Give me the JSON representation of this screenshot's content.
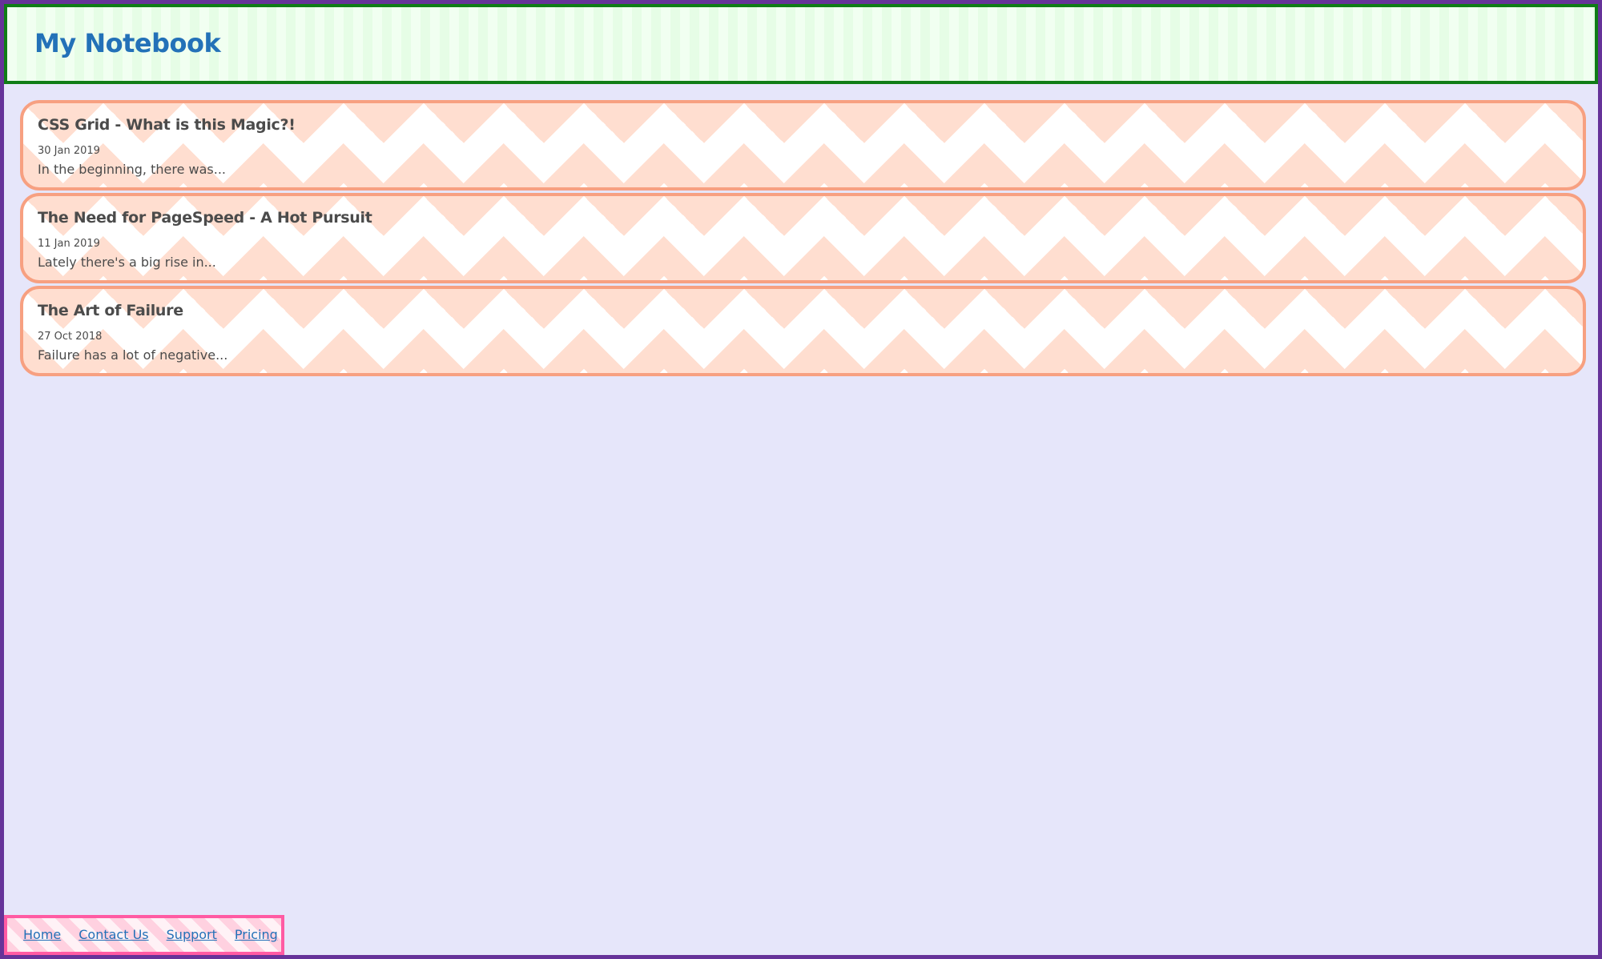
{
  "header": {
    "title": "My Notebook"
  },
  "posts": [
    {
      "title": "CSS Grid - What is this Magic?!",
      "date": "30 Jan 2019",
      "excerpt": "In the beginning, there was..."
    },
    {
      "title": "The Need for PageSpeed - A Hot Pursuit",
      "date": "11 Jan 2019",
      "excerpt": "Lately there's a big rise in..."
    },
    {
      "title": "The Art of Failure",
      "date": "27 Oct 2018",
      "excerpt": "Failure has a lot of negative..."
    }
  ],
  "footer": {
    "links": [
      "Home",
      "Contact Us",
      "Support",
      "Pricing"
    ]
  },
  "colors": {
    "page_border": "#663399",
    "page_background": "#e6e6fa",
    "header_border": "#0f7d16",
    "title_color": "#2371b8",
    "post_border": "#f7a081",
    "footer_border": "#ff5ba3"
  }
}
